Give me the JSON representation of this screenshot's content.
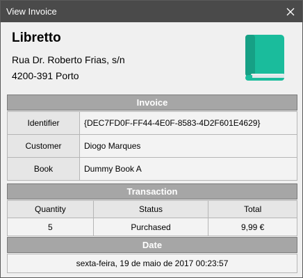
{
  "window": {
    "title": "View Invoice"
  },
  "company": {
    "name": "Libretto",
    "address_line1": "Rua Dr. Roberto Frias, s/n",
    "address_line2": "4200-391 Porto"
  },
  "invoice": {
    "header": "Invoice",
    "rows": [
      {
        "key": "Identifier",
        "value": "{DEC7FD0F-FF44-4E0F-8583-4D2F601E4629}"
      },
      {
        "key": "Customer",
        "value": "Diogo Marques"
      },
      {
        "key": "Book",
        "value": "Dummy Book A"
      }
    ]
  },
  "transaction": {
    "header": "Transaction",
    "columns": [
      "Quantity",
      "Status",
      "Total"
    ],
    "row": [
      "5",
      "Purchased",
      "9,99 €"
    ]
  },
  "date": {
    "header": "Date",
    "value": "sexta-feira, 19 de maio de 2017 00:23:57"
  },
  "colors": {
    "titlebar": "#4a4a4a",
    "section_header": "#a6a6a6",
    "logo_green": "#1abc9c",
    "logo_green_dark": "#16a085"
  },
  "icons": {
    "logo": "book-icon",
    "close": "close-icon"
  }
}
